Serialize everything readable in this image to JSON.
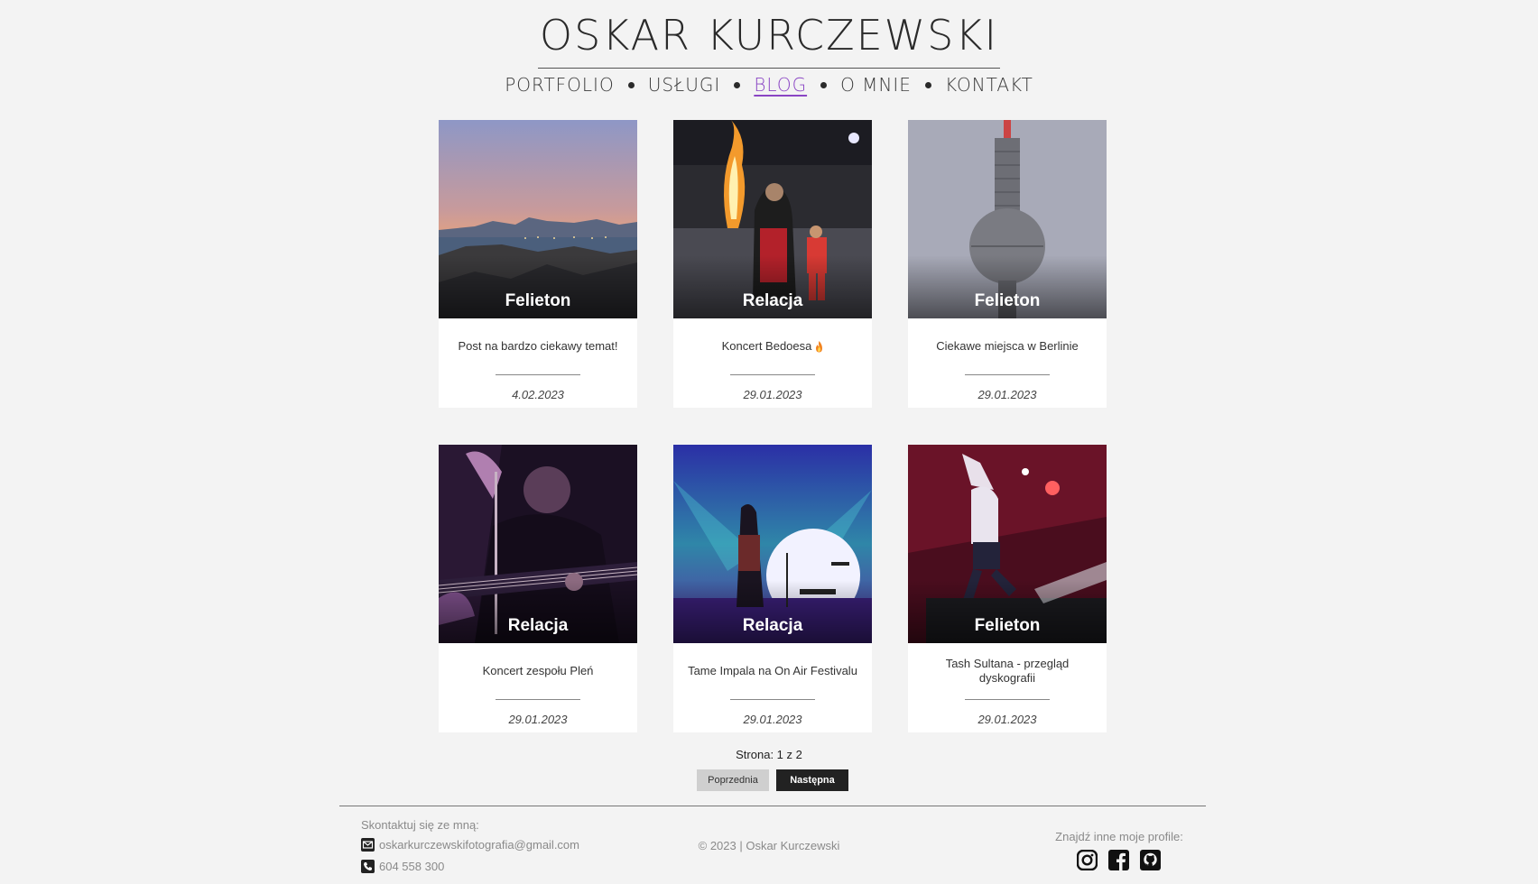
{
  "header": {
    "title": "OSKAR KURCZEWSKI",
    "nav": [
      {
        "label": "PORTFOLIO",
        "active": false
      },
      {
        "label": "USŁUGI",
        "active": false
      },
      {
        "label": "BLOG",
        "active": true
      },
      {
        "label": "O MNIE",
        "active": false
      },
      {
        "label": "KONTAKT",
        "active": false
      }
    ]
  },
  "posts": [
    {
      "category": "Felieton",
      "title": "Post na bardzo ciekawy temat!",
      "date": "4.02.2023",
      "image": "coastal sunset"
    },
    {
      "category": "Relacja",
      "title": "Koncert Bedoesa",
      "date": "29.01.2023",
      "image": "concert with flames",
      "emoji": "fire"
    },
    {
      "category": "Felieton",
      "title": "Ciekawe miejsca w Berlinie",
      "date": "29.01.2023",
      "image": "berlin tv tower"
    },
    {
      "category": "Relacja",
      "title": "Koncert zespołu Pleń",
      "date": "29.01.2023",
      "image": "bass guitarist"
    },
    {
      "category": "Relacja",
      "title": "Tame Impala na On Air Festivalu",
      "date": "29.01.2023",
      "image": "stage with moon light"
    },
    {
      "category": "Felieton",
      "title": "Tash Sultana - przegląd dyskografii",
      "date": "29.01.2023",
      "image": "performer jumping red light"
    }
  ],
  "pagination": {
    "label": "Strona: 1 z 2",
    "prev_label": "Poprzednia",
    "next_label": "Następna"
  },
  "footer": {
    "contact_heading": "Skontaktuj się ze mną:",
    "email": "oskarkurczewskifotografia@gmail.com",
    "phone": "604 558 300",
    "copyright": "© 2023 | Oskar Kurczewski",
    "profiles_heading": "Znajdź inne moje profile:",
    "social_icons": [
      "instagram-icon",
      "facebook-icon",
      "github-icon"
    ]
  },
  "colors": {
    "background": "#f3f3f3",
    "accent": "#8a45c4",
    "next_button": "#222222",
    "prev_button": "#cfcfcf"
  }
}
